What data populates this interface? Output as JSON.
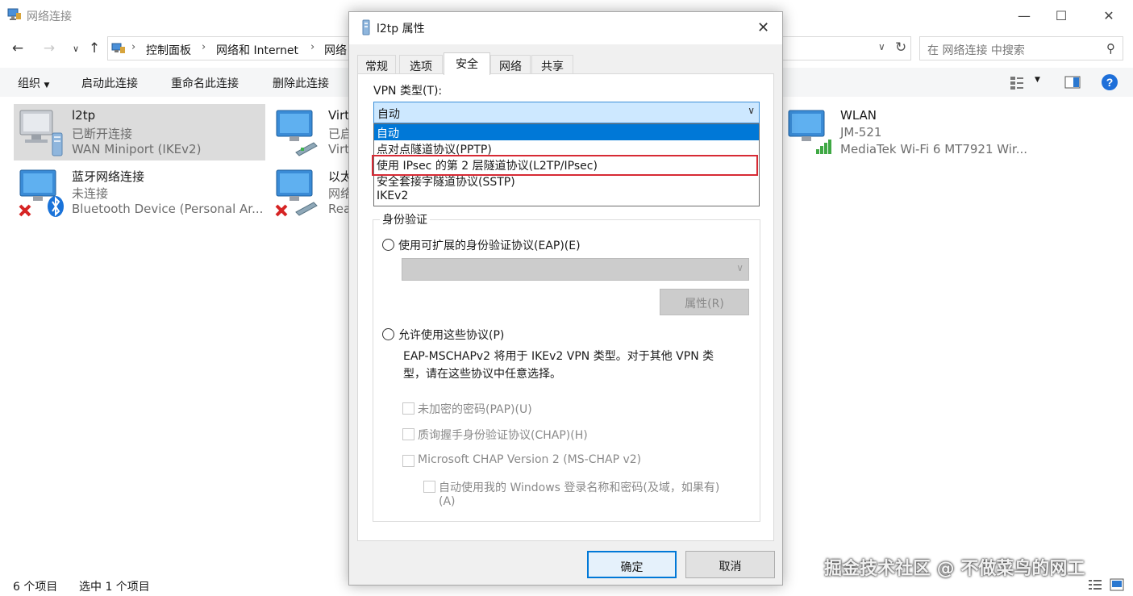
{
  "explorer": {
    "title": "网络连接",
    "breadcrumb": [
      "控制面板",
      "网络和 Internet",
      "网络"
    ],
    "search_placeholder": "在 网络连接 中搜索",
    "toolbar": {
      "organize": "组织",
      "start": "启动此连接",
      "rename": "重命名此连接",
      "delete": "删除此连接"
    },
    "items": [
      {
        "name": "l2tp",
        "status": "已断开连接",
        "device": "WAN Miniport (IKEv2)",
        "icon": "vpn-computer-icon"
      },
      {
        "name": "Virt",
        "status": "已启",
        "device": "Virt",
        "icon": "ethernet-computer-icon"
      },
      {
        "name": "WLAN",
        "status": "JM-521",
        "device": "MediaTek Wi-Fi 6 MT7921 Wir...",
        "icon": "wifi-computer-icon"
      },
      {
        "name": "蓝牙网络连接",
        "status": "未连接",
        "device": "Bluetooth Device (Personal Ar...",
        "icon": "bluetooth-computer-icon"
      },
      {
        "name": "以太",
        "status": "网络",
        "device": "Rea",
        "icon": "ethernet-computer-icon"
      }
    ],
    "status": {
      "count": "6 个项目",
      "selected": "选中 1 个项目"
    }
  },
  "dialog": {
    "title": "l2tp 属性",
    "tabs": [
      "常规",
      "选项",
      "安全",
      "网络",
      "共享"
    ],
    "active_tab": "安全",
    "vpn_type_label": "VPN 类型(T):",
    "vpn_type_value": "自动",
    "vpn_options": [
      "自动",
      "点对点隧道协议(PPTP)",
      "使用 IPsec 的第 2 层隧道协议(L2TP/IPsec)",
      "安全套接字隧道协议(SSTP)",
      "IKEv2"
    ],
    "highlighted_option": "自动",
    "boxed_option": "使用 IPsec 的第 2 层隧道协议(L2TP/IPsec)",
    "auth_legend": "身份验证",
    "eap_radio": "使用可扩展的身份验证协议(EAP)(E)",
    "properties_button": "属性(R)",
    "allow_radio": "允许使用这些协议(P)",
    "desc_line1": "EAP-MSCHAPv2 将用于 IKEv2 VPN 类型。对于其他 VPN 类",
    "desc_line2": "型，请在这些协议中任意选择。",
    "protocols": [
      "未加密的密码(PAP)(U)",
      "质询握手身份验证协议(CHAP)(H)",
      "Microsoft CHAP Version 2 (MS-CHAP v2)"
    ],
    "auto_windows_line1": "自动使用我的 Windows 登录名称和密码(及域，如果有)",
    "auto_windows_line2": "(A)",
    "ok": "确定",
    "cancel": "取消"
  },
  "watermark": "掘金技术社区 @ 不做菜鸟的网工",
  "colors": {
    "accent": "#0078d7",
    "highlight_box": "#d72a34",
    "selected_item": "#dcdcdc",
    "dropdown_selected": "#cde8ff",
    "help": "#1e6fd9"
  }
}
